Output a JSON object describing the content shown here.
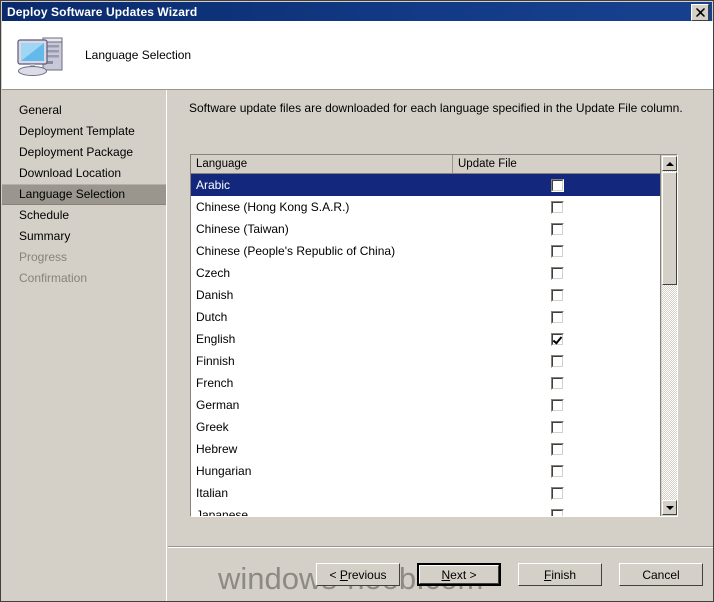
{
  "window": {
    "title": "Deploy Software Updates Wizard",
    "close_label": "✕",
    "close_icon": "close-icon"
  },
  "header": {
    "title": "Language Selection",
    "icon": "computer-icon"
  },
  "sidebar": {
    "items": [
      {
        "label": "General",
        "state": "normal"
      },
      {
        "label": "Deployment Template",
        "state": "normal"
      },
      {
        "label": "Deployment Package",
        "state": "normal"
      },
      {
        "label": "Download Location",
        "state": "normal"
      },
      {
        "label": "Language Selection",
        "state": "selected"
      },
      {
        "label": "Schedule",
        "state": "normal"
      },
      {
        "label": "Summary",
        "state": "normal"
      },
      {
        "label": "Progress",
        "state": "disabled"
      },
      {
        "label": "Confirmation",
        "state": "disabled"
      }
    ]
  },
  "main": {
    "instruction": "Software update files are downloaded for each language specified in the Update File column.",
    "columns": [
      "Language",
      "Update File"
    ],
    "rows": [
      {
        "language": "Arabic",
        "checked": false,
        "selected": true
      },
      {
        "language": "Chinese (Hong Kong S.A.R.)",
        "checked": false,
        "selected": false
      },
      {
        "language": "Chinese (Taiwan)",
        "checked": false,
        "selected": false
      },
      {
        "language": "Chinese (People's Republic of China)",
        "checked": false,
        "selected": false
      },
      {
        "language": "Czech",
        "checked": false,
        "selected": false
      },
      {
        "language": "Danish",
        "checked": false,
        "selected": false
      },
      {
        "language": "Dutch",
        "checked": false,
        "selected": false
      },
      {
        "language": "English",
        "checked": true,
        "selected": false
      },
      {
        "language": "Finnish",
        "checked": false,
        "selected": false
      },
      {
        "language": "French",
        "checked": false,
        "selected": false
      },
      {
        "language": "German",
        "checked": false,
        "selected": false
      },
      {
        "language": "Greek",
        "checked": false,
        "selected": false
      },
      {
        "language": "Hebrew",
        "checked": false,
        "selected": false
      },
      {
        "language": "Hungarian",
        "checked": false,
        "selected": false
      },
      {
        "language": "Italian",
        "checked": false,
        "selected": false
      },
      {
        "language": "Japanese",
        "checked": false,
        "selected": false
      }
    ],
    "scrollbar": {
      "up_icon": "scroll-up-arrow-icon",
      "down_icon": "scroll-down-arrow-icon"
    }
  },
  "footer": {
    "watermark": "windows-noob.com",
    "buttons": [
      {
        "label": "< Previous",
        "accel": "P",
        "default": false
      },
      {
        "label": "Next >",
        "accel": "N",
        "default": true
      },
      {
        "label": "Finish",
        "accel": "F",
        "default": false
      },
      {
        "label": "Cancel",
        "accel": "",
        "default": false
      }
    ]
  },
  "colors": {
    "titlebar": "#13287d",
    "selection": "#13287d",
    "face": "#d4d0c8",
    "sidebar_selected": "#9a968e"
  }
}
